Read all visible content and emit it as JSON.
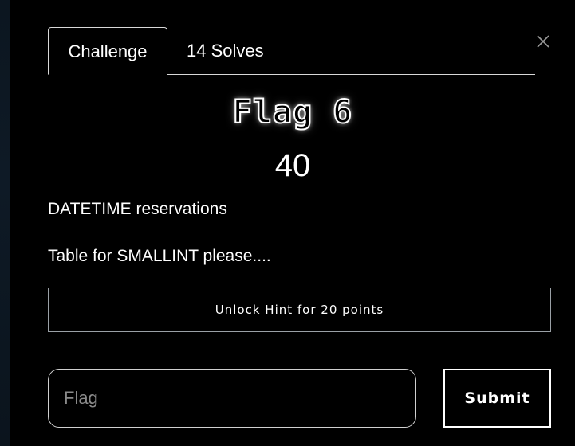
{
  "tabs": {
    "challenge_label": "Challenge",
    "solves_label": "14 Solves"
  },
  "challenge": {
    "name": "Flag 6",
    "points": "40",
    "description_lines": [
      "DATETIME reservations",
      "Table for SMALLINT please...."
    ]
  },
  "hint": {
    "button_label": "Unlock Hint for 20 points"
  },
  "flag_form": {
    "placeholder": "Flag",
    "value": "",
    "submit_label": "Submit"
  },
  "icons": {
    "close": "close-icon"
  },
  "colors": {
    "modal_background": "#000000",
    "page_backdrop": "#0a1016",
    "text": "#ffffff",
    "placeholder": "#8a8a8a",
    "border": "#d8d8d8"
  }
}
